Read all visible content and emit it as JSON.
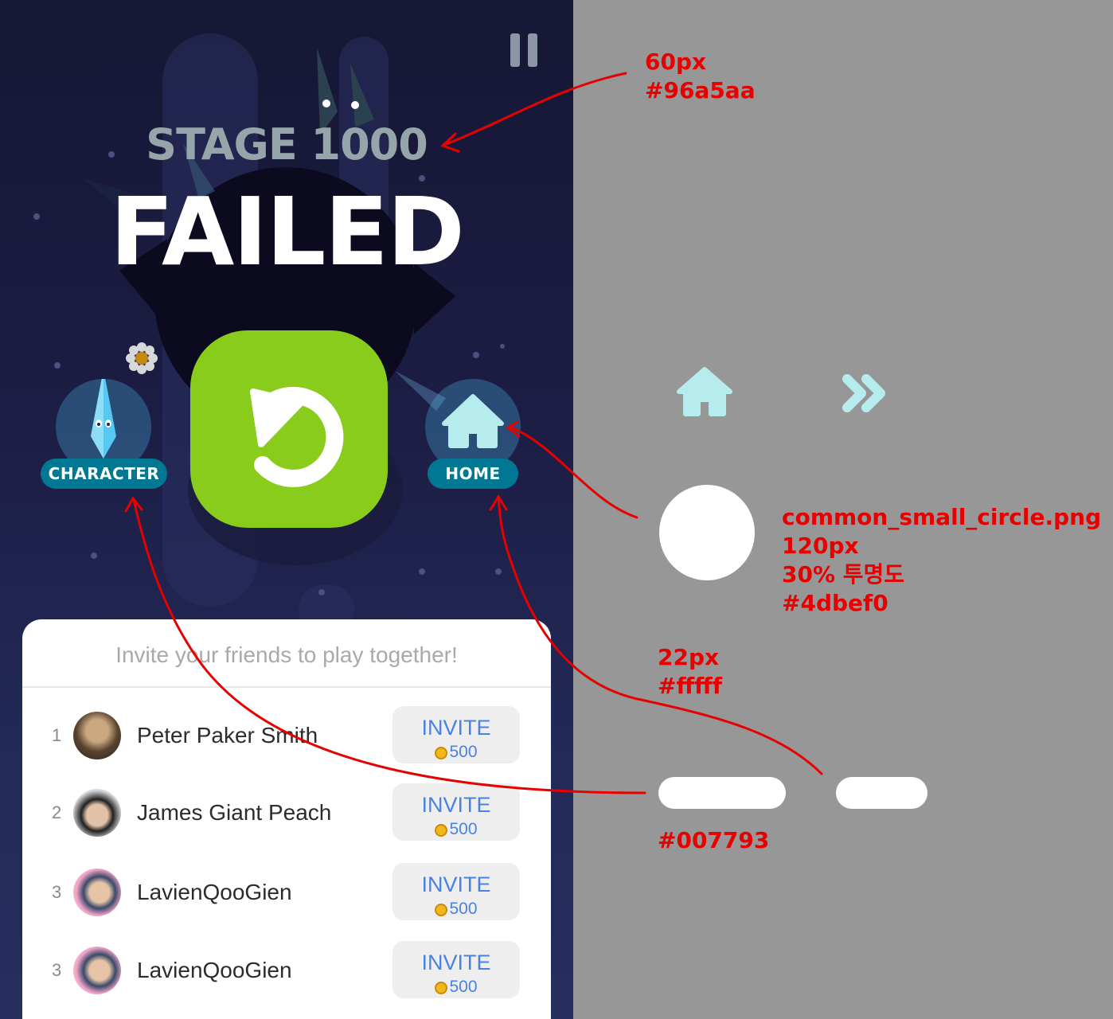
{
  "game": {
    "stage_title": "STAGE 1000",
    "result_title": "FAILED",
    "buttons": {
      "character_label": "CHARACTER",
      "home_label": "HOME",
      "retry_icon": "retry-icon"
    },
    "invite_panel": {
      "header": "Invite your friends to play together!",
      "friends": [
        {
          "rank": "1",
          "name": "Peter Paker Smith",
          "button": "INVITE",
          "reward": "500"
        },
        {
          "rank": "2",
          "name": "James Giant Peach",
          "button": "INVITE",
          "reward": "500"
        },
        {
          "rank": "3",
          "name": "LavienQooGien",
          "button": "INVITE",
          "reward": "500"
        },
        {
          "rank": "3",
          "name": "LavienQooGien",
          "button": "INVITE",
          "reward": "500"
        }
      ]
    }
  },
  "annotations": {
    "title_spec": {
      "size": "60px",
      "color": "#96a5aa"
    },
    "circle_spec": {
      "file": "common_small_circle.png",
      "size": "120px",
      "opacity": "30% 투명도",
      "color": "#4dbef0"
    },
    "label_spec": {
      "size": "22px",
      "color": "#fffff"
    },
    "pill_color": "#007793"
  },
  "colors": {
    "title": "#96a5aa",
    "retry": "#8acc1c",
    "pill": "#007793",
    "circle": "#4dbef0",
    "icon_mint": "#b6ecee",
    "annotation_red": "#e60000"
  }
}
